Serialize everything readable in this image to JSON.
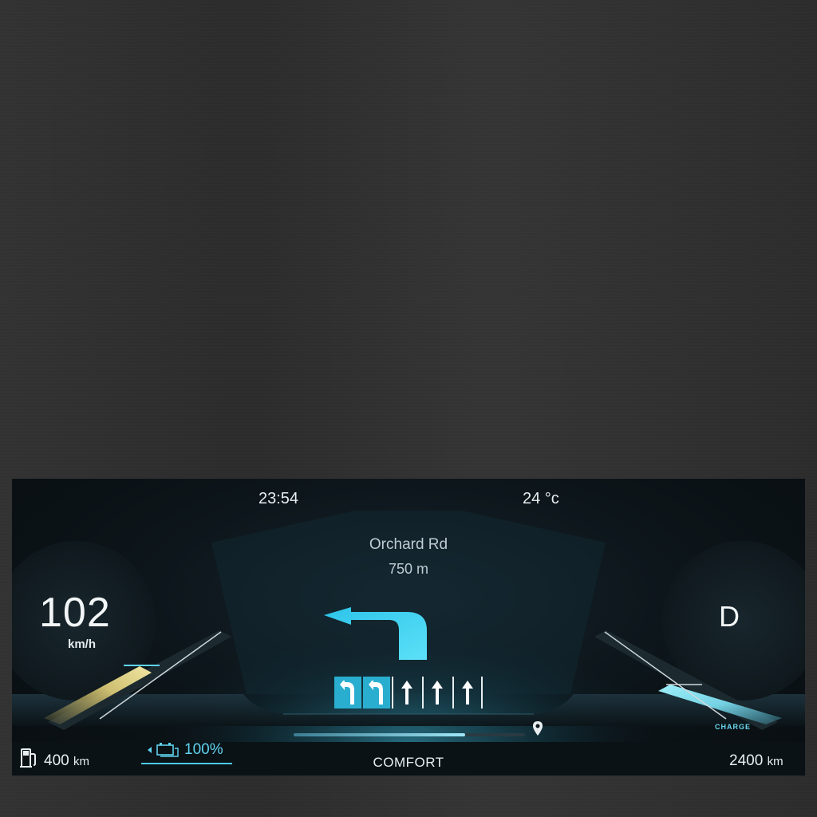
{
  "status": {
    "time": "23:54",
    "temperature": "24 °c"
  },
  "navigation": {
    "street": "Orchard Rd",
    "distance": "750 m",
    "route_progress": 0.74
  },
  "speed": {
    "value": "102",
    "unit": "km/h"
  },
  "gear": {
    "value": "D",
    "charge_label": "CHARGE"
  },
  "footer": {
    "fuel_range_value": "400",
    "fuel_range_unit": "km",
    "battery_level": "100%",
    "drive_mode": "COMFORT",
    "total_range_value": "2400",
    "total_range_unit": "km"
  },
  "lanes": [
    {
      "icon": "turn-left-arrow-icon",
      "active": true
    },
    {
      "icon": "turn-left-arrow-icon",
      "active": true
    },
    {
      "icon": "straight-arrow-icon",
      "active": false
    },
    {
      "icon": "straight-arrow-icon",
      "active": false
    },
    {
      "icon": "straight-arrow-icon",
      "active": false
    }
  ],
  "colors": {
    "accent": "#3fd4f2",
    "left_gauge": "#d8c66a",
    "background": "#0d161b"
  }
}
